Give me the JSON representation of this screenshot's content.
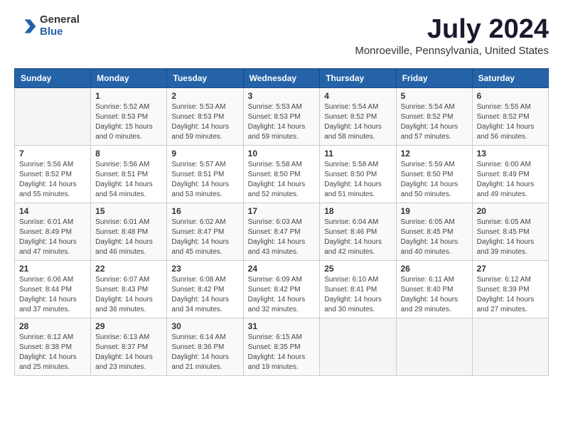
{
  "header": {
    "logo_general": "General",
    "logo_blue": "Blue",
    "month_title": "July 2024",
    "location": "Monroeville, Pennsylvania, United States"
  },
  "calendar": {
    "days_of_week": [
      "Sunday",
      "Monday",
      "Tuesday",
      "Wednesday",
      "Thursday",
      "Friday",
      "Saturday"
    ],
    "weeks": [
      [
        {
          "day": "",
          "info": ""
        },
        {
          "day": "1",
          "info": "Sunrise: 5:52 AM\nSunset: 8:53 PM\nDaylight: 15 hours\nand 0 minutes."
        },
        {
          "day": "2",
          "info": "Sunrise: 5:53 AM\nSunset: 8:53 PM\nDaylight: 14 hours\nand 59 minutes."
        },
        {
          "day": "3",
          "info": "Sunrise: 5:53 AM\nSunset: 8:53 PM\nDaylight: 14 hours\nand 59 minutes."
        },
        {
          "day": "4",
          "info": "Sunrise: 5:54 AM\nSunset: 8:52 PM\nDaylight: 14 hours\nand 58 minutes."
        },
        {
          "day": "5",
          "info": "Sunrise: 5:54 AM\nSunset: 8:52 PM\nDaylight: 14 hours\nand 57 minutes."
        },
        {
          "day": "6",
          "info": "Sunrise: 5:55 AM\nSunset: 8:52 PM\nDaylight: 14 hours\nand 56 minutes."
        }
      ],
      [
        {
          "day": "7",
          "info": "Sunrise: 5:56 AM\nSunset: 8:52 PM\nDaylight: 14 hours\nand 55 minutes."
        },
        {
          "day": "8",
          "info": "Sunrise: 5:56 AM\nSunset: 8:51 PM\nDaylight: 14 hours\nand 54 minutes."
        },
        {
          "day": "9",
          "info": "Sunrise: 5:57 AM\nSunset: 8:51 PM\nDaylight: 14 hours\nand 53 minutes."
        },
        {
          "day": "10",
          "info": "Sunrise: 5:58 AM\nSunset: 8:50 PM\nDaylight: 14 hours\nand 52 minutes."
        },
        {
          "day": "11",
          "info": "Sunrise: 5:58 AM\nSunset: 8:50 PM\nDaylight: 14 hours\nand 51 minutes."
        },
        {
          "day": "12",
          "info": "Sunrise: 5:59 AM\nSunset: 8:50 PM\nDaylight: 14 hours\nand 50 minutes."
        },
        {
          "day": "13",
          "info": "Sunrise: 6:00 AM\nSunset: 8:49 PM\nDaylight: 14 hours\nand 49 minutes."
        }
      ],
      [
        {
          "day": "14",
          "info": "Sunrise: 6:01 AM\nSunset: 8:49 PM\nDaylight: 14 hours\nand 47 minutes."
        },
        {
          "day": "15",
          "info": "Sunrise: 6:01 AM\nSunset: 8:48 PM\nDaylight: 14 hours\nand 46 minutes."
        },
        {
          "day": "16",
          "info": "Sunrise: 6:02 AM\nSunset: 8:47 PM\nDaylight: 14 hours\nand 45 minutes."
        },
        {
          "day": "17",
          "info": "Sunrise: 6:03 AM\nSunset: 8:47 PM\nDaylight: 14 hours\nand 43 minutes."
        },
        {
          "day": "18",
          "info": "Sunrise: 6:04 AM\nSunset: 8:46 PM\nDaylight: 14 hours\nand 42 minutes."
        },
        {
          "day": "19",
          "info": "Sunrise: 6:05 AM\nSunset: 8:45 PM\nDaylight: 14 hours\nand 40 minutes."
        },
        {
          "day": "20",
          "info": "Sunrise: 6:05 AM\nSunset: 8:45 PM\nDaylight: 14 hours\nand 39 minutes."
        }
      ],
      [
        {
          "day": "21",
          "info": "Sunrise: 6:06 AM\nSunset: 8:44 PM\nDaylight: 14 hours\nand 37 minutes."
        },
        {
          "day": "22",
          "info": "Sunrise: 6:07 AM\nSunset: 8:43 PM\nDaylight: 14 hours\nand 36 minutes."
        },
        {
          "day": "23",
          "info": "Sunrise: 6:08 AM\nSunset: 8:42 PM\nDaylight: 14 hours\nand 34 minutes."
        },
        {
          "day": "24",
          "info": "Sunrise: 6:09 AM\nSunset: 8:42 PM\nDaylight: 14 hours\nand 32 minutes."
        },
        {
          "day": "25",
          "info": "Sunrise: 6:10 AM\nSunset: 8:41 PM\nDaylight: 14 hours\nand 30 minutes."
        },
        {
          "day": "26",
          "info": "Sunrise: 6:11 AM\nSunset: 8:40 PM\nDaylight: 14 hours\nand 29 minutes."
        },
        {
          "day": "27",
          "info": "Sunrise: 6:12 AM\nSunset: 8:39 PM\nDaylight: 14 hours\nand 27 minutes."
        }
      ],
      [
        {
          "day": "28",
          "info": "Sunrise: 6:12 AM\nSunset: 8:38 PM\nDaylight: 14 hours\nand 25 minutes."
        },
        {
          "day": "29",
          "info": "Sunrise: 6:13 AM\nSunset: 8:37 PM\nDaylight: 14 hours\nand 23 minutes."
        },
        {
          "day": "30",
          "info": "Sunrise: 6:14 AM\nSunset: 8:36 PM\nDaylight: 14 hours\nand 21 minutes."
        },
        {
          "day": "31",
          "info": "Sunrise: 6:15 AM\nSunset: 8:35 PM\nDaylight: 14 hours\nand 19 minutes."
        },
        {
          "day": "",
          "info": ""
        },
        {
          "day": "",
          "info": ""
        },
        {
          "day": "",
          "info": ""
        }
      ]
    ]
  }
}
